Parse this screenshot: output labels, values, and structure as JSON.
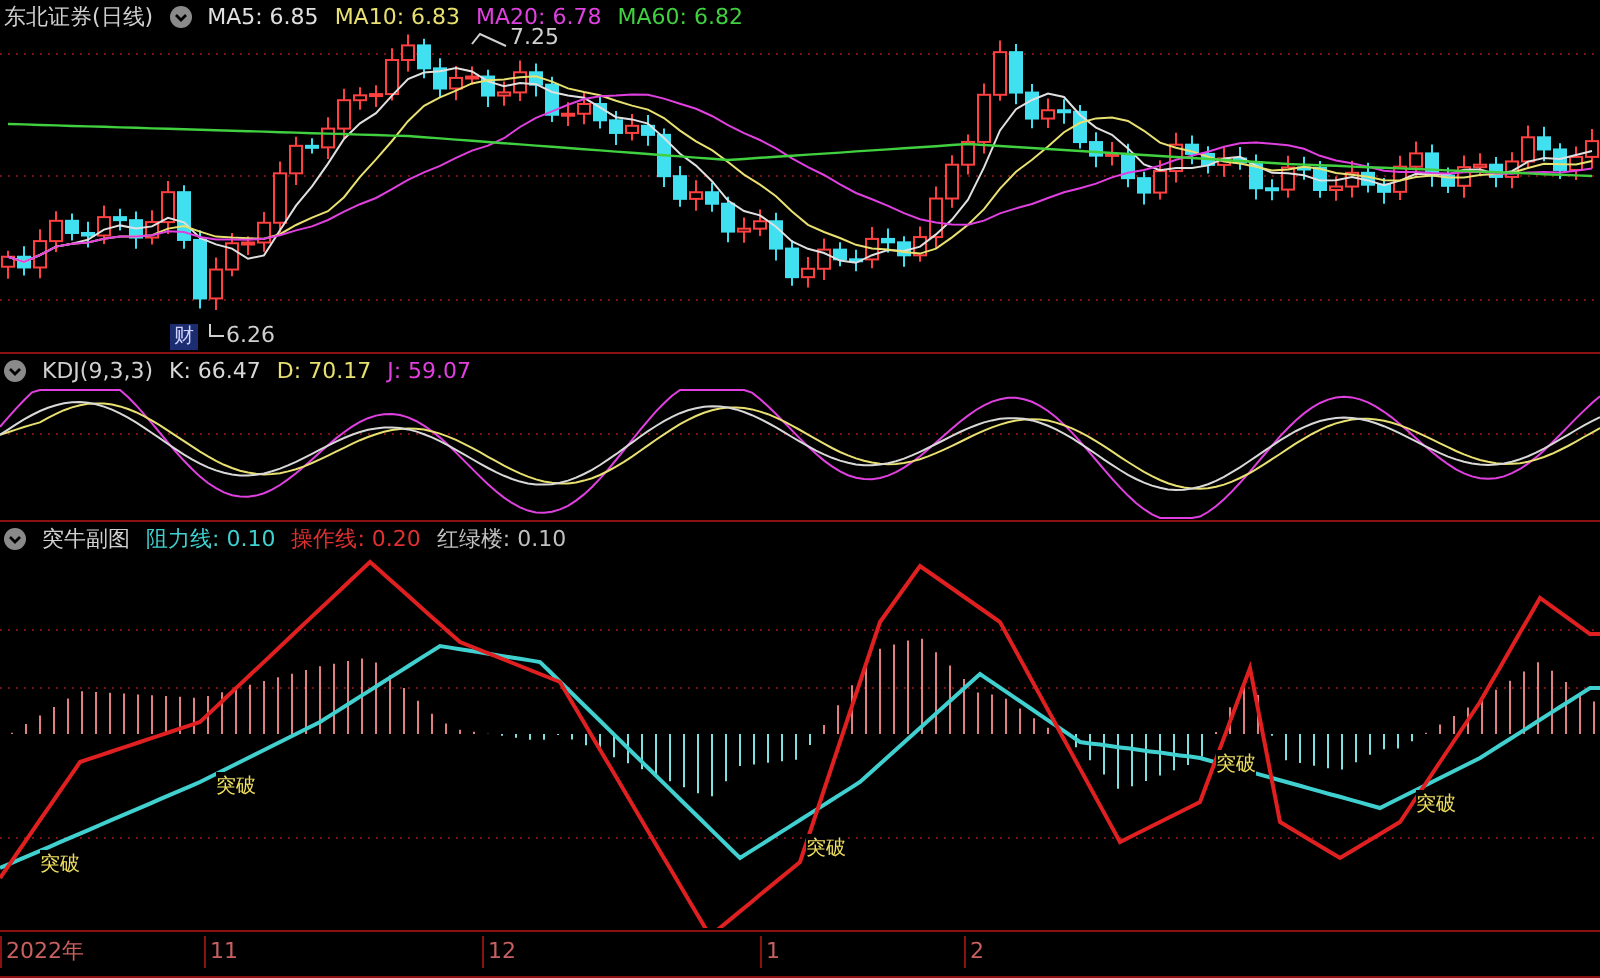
{
  "main_panel": {
    "title": "东北证券(日线)",
    "indicators": [
      {
        "label": "MA5: 6.85",
        "color": "#e0e0e0"
      },
      {
        "label": "MA10: 6.83",
        "color": "#e8e070"
      },
      {
        "label": "MA20: 6.78",
        "color": "#e040e0"
      },
      {
        "label": "MA60: 6.82",
        "color": "#40d040"
      }
    ],
    "high_label": "7.25",
    "low_label": "6.26",
    "event_badge": "财"
  },
  "kdj_panel": {
    "title": "KDJ(9,3,3)",
    "indicators": [
      {
        "label": "K: 66.47",
        "color": "#d8d8d8"
      },
      {
        "label": "D: 70.17",
        "color": "#e8e070"
      },
      {
        "label": "J: 59.07",
        "color": "#e040e0"
      }
    ]
  },
  "sub_panel": {
    "title": "突牛副图",
    "indicators": [
      {
        "label": "阻力线: 0.10",
        "color": "#40d0d0"
      },
      {
        "label": "操作线: 0.20",
        "color": "#e03030"
      },
      {
        "label": "红绿楼: 0.10",
        "color": "#c0c0c0"
      }
    ],
    "signals": [
      "突破",
      "突破",
      "突破",
      "突破",
      "突破"
    ]
  },
  "time_axis": {
    "labels": [
      "2022年",
      "11",
      "12",
      "1",
      "2"
    ]
  }
}
